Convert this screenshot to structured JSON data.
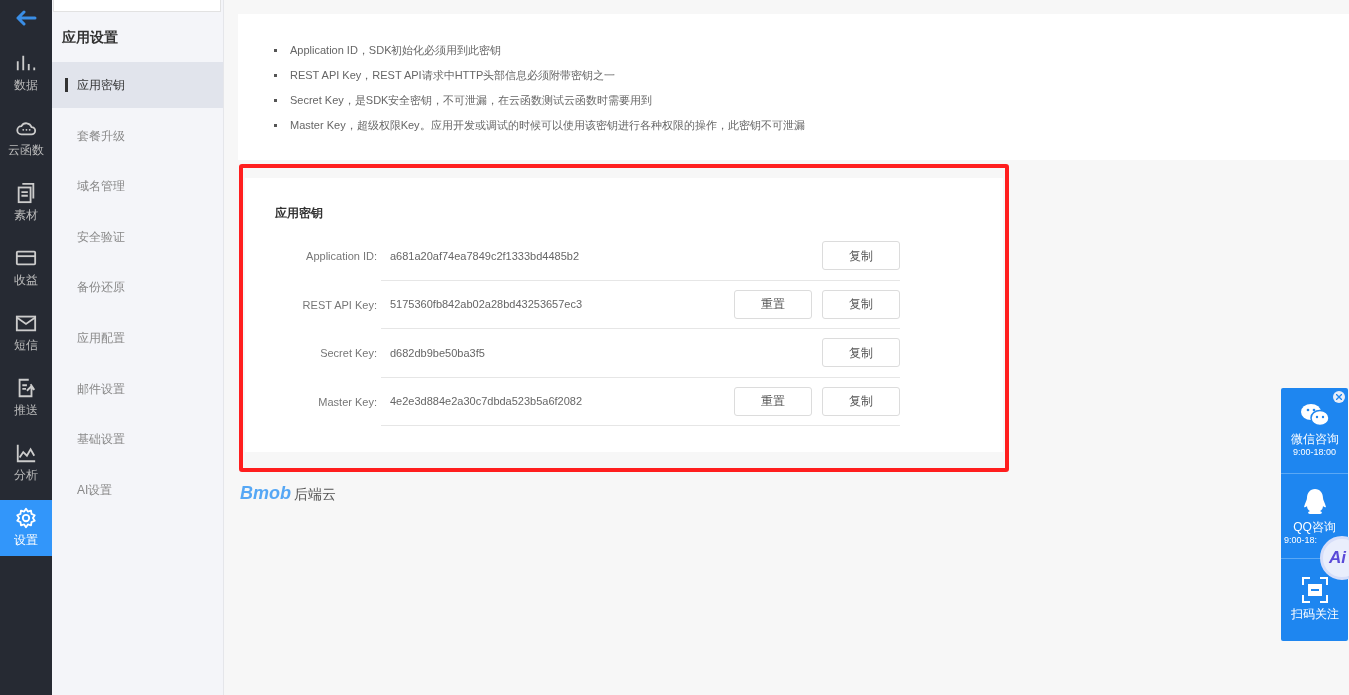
{
  "rail": [
    {
      "label": "数据",
      "selected": false
    },
    {
      "label": "云函数",
      "selected": false
    },
    {
      "label": "素材",
      "selected": false
    },
    {
      "label": "收益",
      "selected": false
    },
    {
      "label": "短信",
      "selected": false
    },
    {
      "label": "推送",
      "selected": false
    },
    {
      "label": "分析",
      "selected": false
    },
    {
      "label": "设置",
      "selected": true
    }
  ],
  "submenu": {
    "title": "应用设置",
    "items": [
      {
        "label": "应用密钥",
        "selected": true
      },
      {
        "label": "套餐升级",
        "selected": false
      },
      {
        "label": "域名管理",
        "selected": false
      },
      {
        "label": "安全验证",
        "selected": false
      },
      {
        "label": "备份还原",
        "selected": false
      },
      {
        "label": "应用配置",
        "selected": false
      },
      {
        "label": "邮件设置",
        "selected": false
      },
      {
        "label": "基础设置",
        "selected": false
      },
      {
        "label": "AI设置",
        "selected": false
      }
    ]
  },
  "notes": [
    "Application ID，SDK初始化必须用到此密钥",
    "REST API Key，REST API请求中HTTP头部信息必须附带密钥之一",
    "Secret Key，是SDK安全密钥，不可泄漏，在云函数测试云函数时需要用到",
    "Master Key，超级权限Key。应用开发或调试的时候可以使用该密钥进行各种权限的操作，此密钥不可泄漏"
  ],
  "keys": {
    "title": "应用密钥",
    "rows": [
      {
        "label": "Application ID:",
        "value": "a681a20af74ea7849c2f1333bd4485b2",
        "buttons": [
          "复制"
        ]
      },
      {
        "label": "REST API Key:",
        "value": "5175360fb842ab02a28bd43253657ec3",
        "buttons": [
          "重置",
          "复制"
        ]
      },
      {
        "label": "Secret Key:",
        "value": "d682db9be50ba3f5",
        "buttons": [
          "复制"
        ]
      },
      {
        "label": "Master Key:",
        "value": "4e2e3d884e2a30c7dbda523b5a6f2082",
        "buttons": [
          "重置",
          "复制"
        ]
      }
    ]
  },
  "footer": {
    "logo": "Bmob",
    "text": "后端云"
  },
  "contact": [
    {
      "label": "微信咨询",
      "hours": "9:00-18:00"
    },
    {
      "label": "QQ咨询",
      "hours": "9:00-18:"
    },
    {
      "label": "扫码关注"
    }
  ],
  "ai_button": {
    "label": "Ai"
  }
}
